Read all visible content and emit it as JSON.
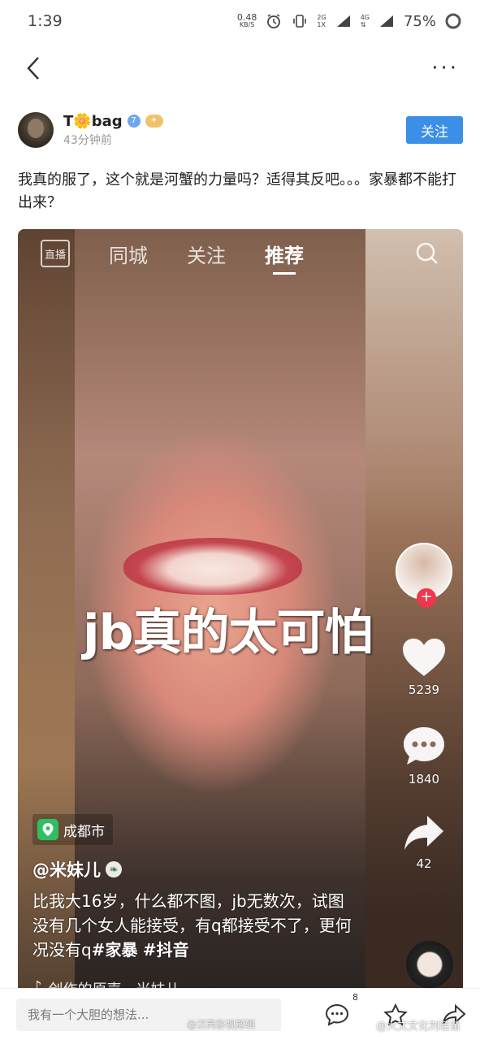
{
  "status_bar": {
    "time": "1:39",
    "net_speed_value": "0.48",
    "net_speed_unit": "KB/S",
    "network_1": "2G",
    "network_1_sub": "1X",
    "network_2": "4G",
    "battery": "75%"
  },
  "nav": {
    "back_icon": "chevron-left-icon",
    "more_icon": "more-dots-icon"
  },
  "post": {
    "username": "T🌼bag",
    "verify_level": "7",
    "time_ago": "43分钟前",
    "follow_label": "关注",
    "text": "我真的服了，这个就是河蟹的力量吗？适得其反吧。。。家暴都不能打出来？"
  },
  "embed": {
    "tabs": {
      "live": "直播",
      "city": "同城",
      "follow": "关注",
      "recommend": "推荐"
    },
    "caption": "jb真的太可怕",
    "likes": "5239",
    "comments": "1840",
    "shares": "42",
    "location": "成都市",
    "creator": "@米妹儿",
    "description_plain": "比我大16岁，什么都不图，jb无数次，试图没有几个女人能接受，有q都接受不了，更何况没有q",
    "tag_1": "#家暴",
    "tag_2": "#抖音",
    "music": "创作的原声 - 米妹儿",
    "accent_like": "#f0364a",
    "accent_location": "#2fbf63"
  },
  "bottom_bar": {
    "comment_placeholder": "我有一个大胆的想法...",
    "comment_count": "8",
    "watermark_left": "@汉芮影视剪辑",
    "watermark_right": "@大文文化刘若苗"
  },
  "colors": {
    "follow_button": "#3c8fe6",
    "text": "#222222"
  }
}
